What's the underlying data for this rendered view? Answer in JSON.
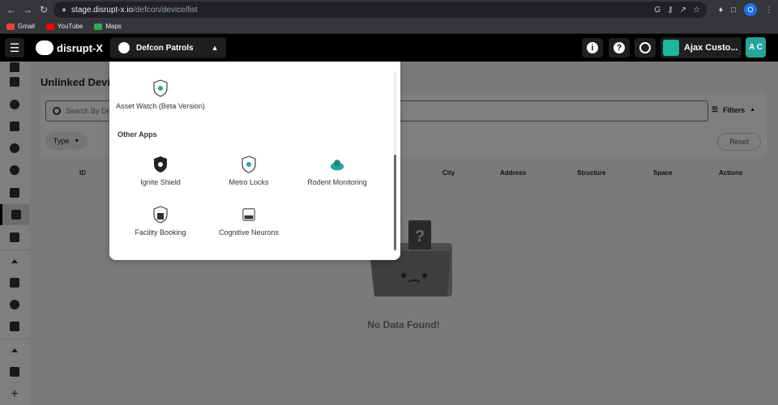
{
  "browser": {
    "url_host": "stage.disrupt-x.io",
    "url_path": "/defcon/device/list",
    "profile_initial": "O",
    "bookmarks": [
      {
        "label": "Gmail",
        "color": "#ea4335"
      },
      {
        "label": "YouTube",
        "color": "#ff0000"
      },
      {
        "label": "Maps",
        "color": "#34a853"
      }
    ]
  },
  "header": {
    "logo_text": "disrupt-X",
    "app_switcher_label": "Defcon Patrols",
    "customer_name": "Ajax Custo...",
    "user_initials": "A C"
  },
  "main": {
    "title": "Unlinked Devic",
    "search_placeholder": "Search By De",
    "filters_label": "Filters",
    "type_label": "Type",
    "reset_label": "Reset",
    "table_headers": [
      "ID",
      "City",
      "Address",
      "Structure",
      "Space",
      "Actions"
    ],
    "empty_text": "No Data Found!"
  },
  "menu": {
    "top_apps": [
      {
        "label": "Asset Watch (Beta Version)",
        "icon": "asset-watch-icon"
      }
    ],
    "section_title": "Other Apps",
    "other_apps": [
      {
        "label": "Ignite Shield",
        "icon": "ignite-shield-icon"
      },
      {
        "label": "Metro Locks",
        "icon": "metro-locks-icon"
      },
      {
        "label": "Rodent Monitoring",
        "icon": "rodent-monitoring-icon"
      },
      {
        "label": "Facility Booking",
        "icon": "facility-booking-icon"
      },
      {
        "label": "Cognitive Neurons",
        "icon": "cognitive-neurons-icon"
      }
    ]
  },
  "colors": {
    "accent_teal": "#26a69a",
    "header_bg": "#000000"
  }
}
